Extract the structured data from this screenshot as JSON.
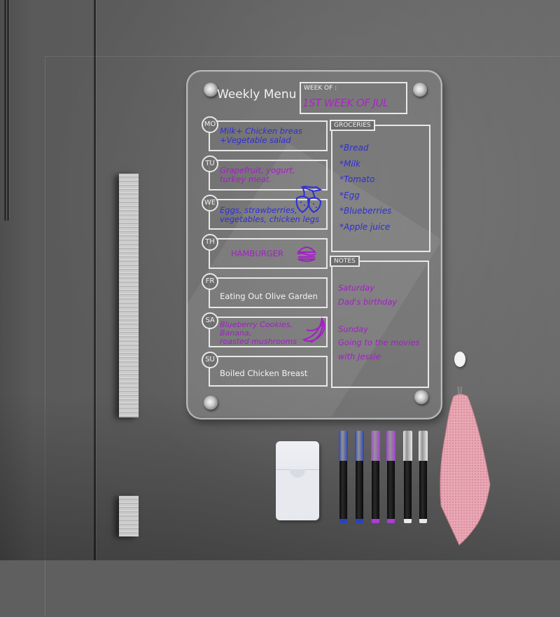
{
  "scene": {
    "description": "Acrylic weekly menu board mounted on a dark grey refrigerator door, with marker holder, six dry-erase markers and a pink towel on a hook"
  },
  "board": {
    "title": "Weekly Menu",
    "week_of_label": "WEEK OF :",
    "week_of_value": "1ST WEEK OF JUL",
    "days": [
      {
        "abbr": "MO",
        "text": "Milk+ Chicken breas\n+Vegetable salad",
        "ink": "blue"
      },
      {
        "abbr": "TU",
        "text": "Grapefruit, yogurt,\nturkey meat.",
        "ink": "purple"
      },
      {
        "abbr": "WE",
        "text": "Eggs, strawberries,\nvegetables, chicken legs",
        "ink": "blue",
        "doodle": "strawberries-icon"
      },
      {
        "abbr": "TH",
        "text": "HAMBURGER",
        "ink": "purple",
        "doodle": "hamburger-icon"
      },
      {
        "abbr": "FR",
        "text": "Eating Out Olive Garden",
        "ink": "white"
      },
      {
        "abbr": "SA",
        "text": "Blueberry Cookies,\nBanana,\nroasted mushrooms",
        "ink": "purple",
        "doodle": "banana-icon"
      },
      {
        "abbr": "SU",
        "text": "Boiled Chicken Breast",
        "ink": "white"
      }
    ],
    "groceries": {
      "label": "GROCERIES",
      "items": [
        "*Bread",
        "*Milk",
        "*Tomato",
        "*Egg",
        "*Blueberries",
        "*Apple juice"
      ]
    },
    "notes": {
      "label": "NOTES",
      "text": "Saturday\nDad's birthday\n\nSunday\nGoing to the movies\nwith Jessie"
    }
  },
  "accessories": {
    "markers": [
      {
        "color": "blue",
        "hex": "#2a43b8"
      },
      {
        "color": "blue",
        "hex": "#2a43b8"
      },
      {
        "color": "purple",
        "hex": "#a63fd6"
      },
      {
        "color": "purple",
        "hex": "#a63fd6"
      },
      {
        "color": "white",
        "hex": "#eaeaea"
      },
      {
        "color": "white",
        "hex": "#eaeaea"
      }
    ],
    "towel_color": "#e8a6b2",
    "holder_color": "#e6e8ee"
  },
  "colors": {
    "ink_blue": "#2f2ed6",
    "ink_purple": "#a61ccc",
    "ink_white": "#f4f4f4",
    "fridge": "#5f5f5f"
  }
}
